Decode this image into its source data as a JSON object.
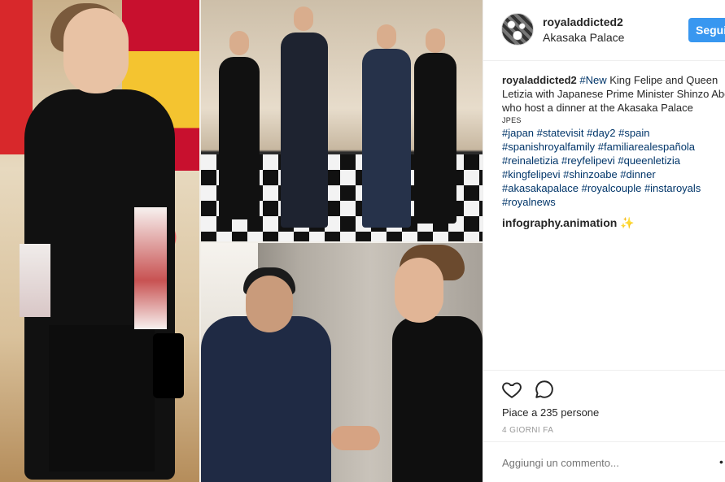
{
  "post": {
    "username": "royaladdicted2",
    "location": "Akasaka Palace",
    "follow_label": "Segui",
    "caption": {
      "user": "royaladdicted2",
      "lead_tag": "#New",
      "text": " King Felipe and Queen Letizia with Japanese Prime Minister Shinzo Abe, who host a dinner at the Akasaka Palace",
      "credit": "JPES",
      "hashtags": [
        "#japan",
        "#statevisit",
        "#day2",
        "#spain",
        "#spanishroyalfamily",
        "#familiarealespañola",
        "#reinaletizia",
        "#reyfelipevi",
        "#queenletizia",
        "#kingfelipevi",
        "#shinzoabe",
        "#dinner",
        "#akasakapalace",
        "#royalcouple",
        "#instaroyals",
        "#royalnews"
      ]
    },
    "comment": {
      "user": "infography.animation",
      "emoji": "✨"
    },
    "likes_text": "Piace a 235 persone",
    "time_text": "4 GIORNI FA",
    "comment_placeholder": "Aggiungi un commento...",
    "more_label": "•"
  },
  "icons": {
    "like": "heart-icon",
    "comment": "comment-bubble-icon"
  },
  "colors": {
    "follow_button": "#3897f0",
    "hashtag": "#003569",
    "muted_text": "#999999",
    "divider": "#efefef"
  }
}
